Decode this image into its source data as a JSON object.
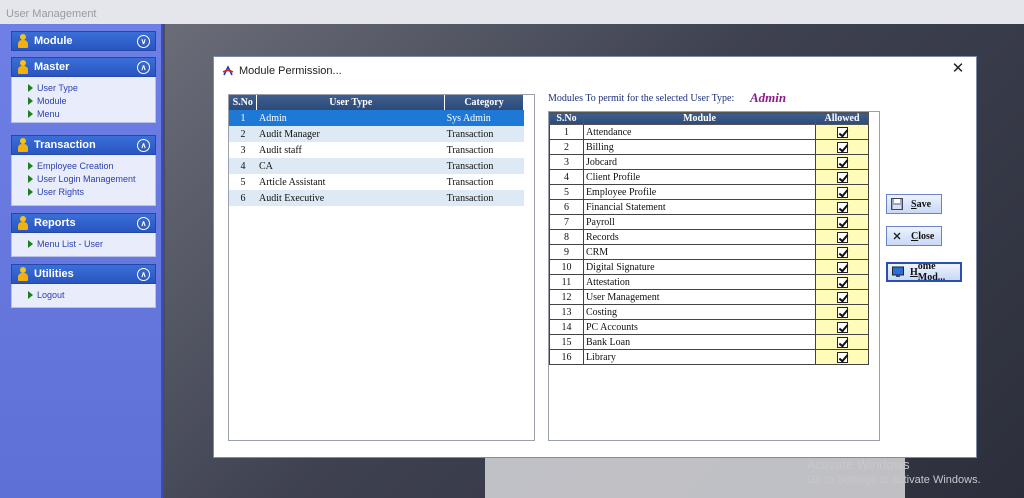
{
  "window": {
    "title": "User Management"
  },
  "sidebar": {
    "panels": [
      {
        "title": "Module",
        "expanded": false,
        "items": []
      },
      {
        "title": "Master",
        "expanded": true,
        "items": [
          "User Type",
          "Module",
          "Menu"
        ]
      },
      {
        "title": "Transaction",
        "expanded": true,
        "items": [
          "Employee Creation",
          "User Login Management",
          "User Rights"
        ]
      },
      {
        "title": "Reports",
        "expanded": true,
        "items": [
          "Menu List - User"
        ]
      },
      {
        "title": "Utilities",
        "expanded": true,
        "items": [
          "Logout"
        ]
      }
    ]
  },
  "dialog": {
    "title": "Module Permission...",
    "close_glyph": "✕",
    "user_types": {
      "headers": [
        "S.No",
        "User Type",
        "Category"
      ],
      "rows": [
        [
          "1",
          "Admin",
          "Sys Admin"
        ],
        [
          "2",
          "Audit Manager",
          "Transaction"
        ],
        [
          "3",
          "Audit staff",
          "Transaction"
        ],
        [
          "4",
          "CA",
          "Transaction"
        ],
        [
          "5",
          "Article Assistant",
          "Transaction"
        ],
        [
          "6",
          "Audit Executive",
          "Transaction"
        ]
      ],
      "selected_index": 0
    },
    "permission_label": "Modules To permit for the selected User Type:",
    "selected_user_type": "Admin",
    "modules": {
      "headers": [
        "S.No",
        "Module",
        "Allowed"
      ],
      "rows": [
        [
          "1",
          "Attendance"
        ],
        [
          "2",
          "Billing"
        ],
        [
          "3",
          "Jobcard"
        ],
        [
          "4",
          "Client Profile"
        ],
        [
          "5",
          "Employee Profile"
        ],
        [
          "6",
          "Financial Statement"
        ],
        [
          "7",
          "Payroll"
        ],
        [
          "8",
          "Records"
        ],
        [
          "9",
          "CRM"
        ],
        [
          "10",
          "Digital Signature"
        ],
        [
          "11",
          "Attestation"
        ],
        [
          "12",
          "User Management"
        ],
        [
          "13",
          "Costing"
        ],
        [
          "14",
          "PC Accounts"
        ],
        [
          "15",
          "Bank Loan"
        ],
        [
          "16",
          "Library"
        ]
      ],
      "allowed": [
        true,
        true,
        true,
        true,
        true,
        true,
        true,
        true,
        true,
        true,
        true,
        true,
        true,
        true,
        true,
        true
      ]
    },
    "buttons": {
      "save": {
        "label_first": "S",
        "label_rest": "ave"
      },
      "close": {
        "label_first": "C",
        "label_rest": "lose"
      },
      "home": {
        "label_first": "H",
        "label_rest": "ome Mod..."
      }
    }
  },
  "watermark": {
    "line1": "Activate Windows",
    "line2": "Go to Settings to activate Windows."
  },
  "colors": {
    "sidebar_bg": "#6e80e6",
    "panel_header": "#2a55c0",
    "grid_header": "#2c4a78",
    "selected_row": "#1e78d6",
    "allowed_cell": "#fffbb8",
    "user_type_accent": "#8a1c8a"
  }
}
